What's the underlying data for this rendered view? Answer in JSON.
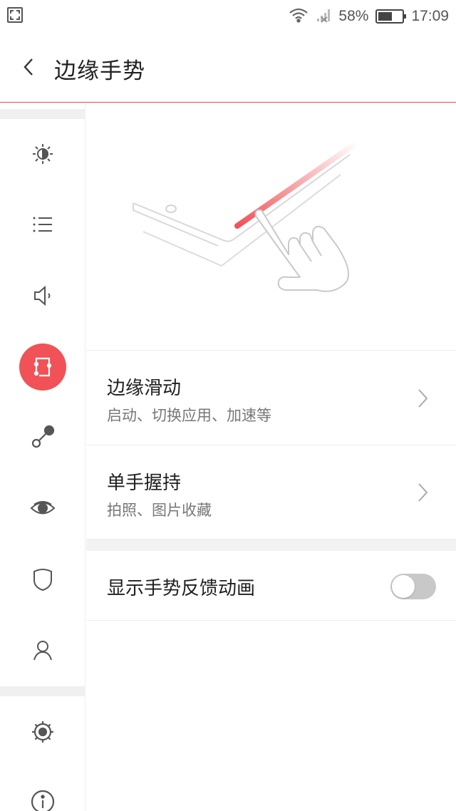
{
  "status_bar": {
    "battery_percent_label": "58%",
    "battery_level": 0.58,
    "time": "17:09",
    "icons": [
      "screenshot-icon",
      "wifi-icon",
      "no-signal-icon",
      "battery-icon"
    ]
  },
  "header": {
    "title": "边缘手势",
    "back_icon": "chevron-left-icon"
  },
  "sidebar": {
    "items": [
      {
        "icon": "brightness-icon",
        "active": false
      },
      {
        "icon": "list-icon",
        "active": false
      },
      {
        "icon": "speaker-icon",
        "active": false
      },
      {
        "icon": "edge-gesture-icon",
        "active": true
      },
      {
        "icon": "connection-icon",
        "active": false
      },
      {
        "icon": "eye-icon",
        "active": false
      },
      {
        "icon": "shield-icon",
        "active": false
      },
      {
        "icon": "user-icon",
        "active": false
      },
      {
        "icon": "gear-icon",
        "active": false
      },
      {
        "icon": "info-icon",
        "active": false
      }
    ]
  },
  "main": {
    "illustration_icon": "edge-swipe-hand-illustration",
    "items": [
      {
        "title": "边缘滑动",
        "subtitle": "启动、切换应用、加速等",
        "icon": "chevron-right-icon"
      },
      {
        "title": "单手握持",
        "subtitle": "拍照、图片收藏",
        "icon": "chevron-right-icon"
      }
    ],
    "toggle_item": {
      "title": "显示手势反馈动画",
      "enabled": false
    }
  },
  "colors": {
    "accent": "#f05257",
    "toggle_off": "#c8c8c8",
    "divider": "#ededed"
  }
}
